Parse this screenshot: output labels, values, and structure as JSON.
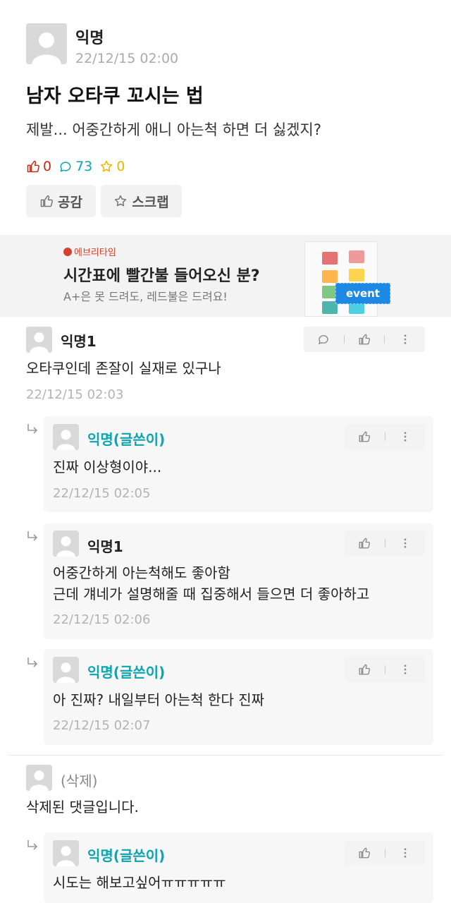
{
  "post": {
    "author": "익명",
    "date": "22/12/15 02:00",
    "title": "남자 오타쿠 꼬시는 법",
    "body": "제발... 어중간하게 애니 아는척 하면 더 싫겠지?",
    "likes": "0",
    "comments": "73",
    "scraps": "0",
    "like_button": "공감",
    "scrap_button": "스크랩"
  },
  "ad": {
    "brand": "에브리타임",
    "title": "시간표에 빨간불 들어오신 분?",
    "subtitle": "A+은 못 드려도, 레드불은 드려요!",
    "badge": "event"
  },
  "comments": [
    {
      "author": "익명1",
      "text": "오타쿠인데 존잘이 실재로 있구나",
      "date": "22/12/15 02:03"
    },
    {
      "author": "익명(글쓴이)",
      "text": "진짜 이상형이야...",
      "date": "22/12/15 02:05"
    },
    {
      "author": "익명1",
      "text": "어중간하게 아는척해도 좋아함\n근데 걔네가 설명해줄 때 집중해서 들으면 더 좋아하고",
      "date": "22/12/15 02:06"
    },
    {
      "author": "익명(글쓴이)",
      "text": "아 진짜? 내일부터 아는척 한다 진짜",
      "date": "22/12/15 02:07"
    },
    {
      "author": "(삭제)",
      "text": "삭제된 댓글입니다.",
      "date": ""
    },
    {
      "author": "익명(글쓴이)",
      "text": "시도는 해보고싶어ㅠㅠㅠㅠㅠ",
      "date": ""
    }
  ],
  "colors": {
    "accent_teal": "#0ca5af",
    "like_red": "#c62917",
    "scrap_yellow": "#f0b400",
    "ad_red": "#d6402c",
    "ad_event_blue": "#1e88e5"
  },
  "icons": [
    "avatar-icon",
    "thumbs-up-icon",
    "comment-icon",
    "star-icon",
    "more-icon",
    "reply-arrow-icon"
  ]
}
